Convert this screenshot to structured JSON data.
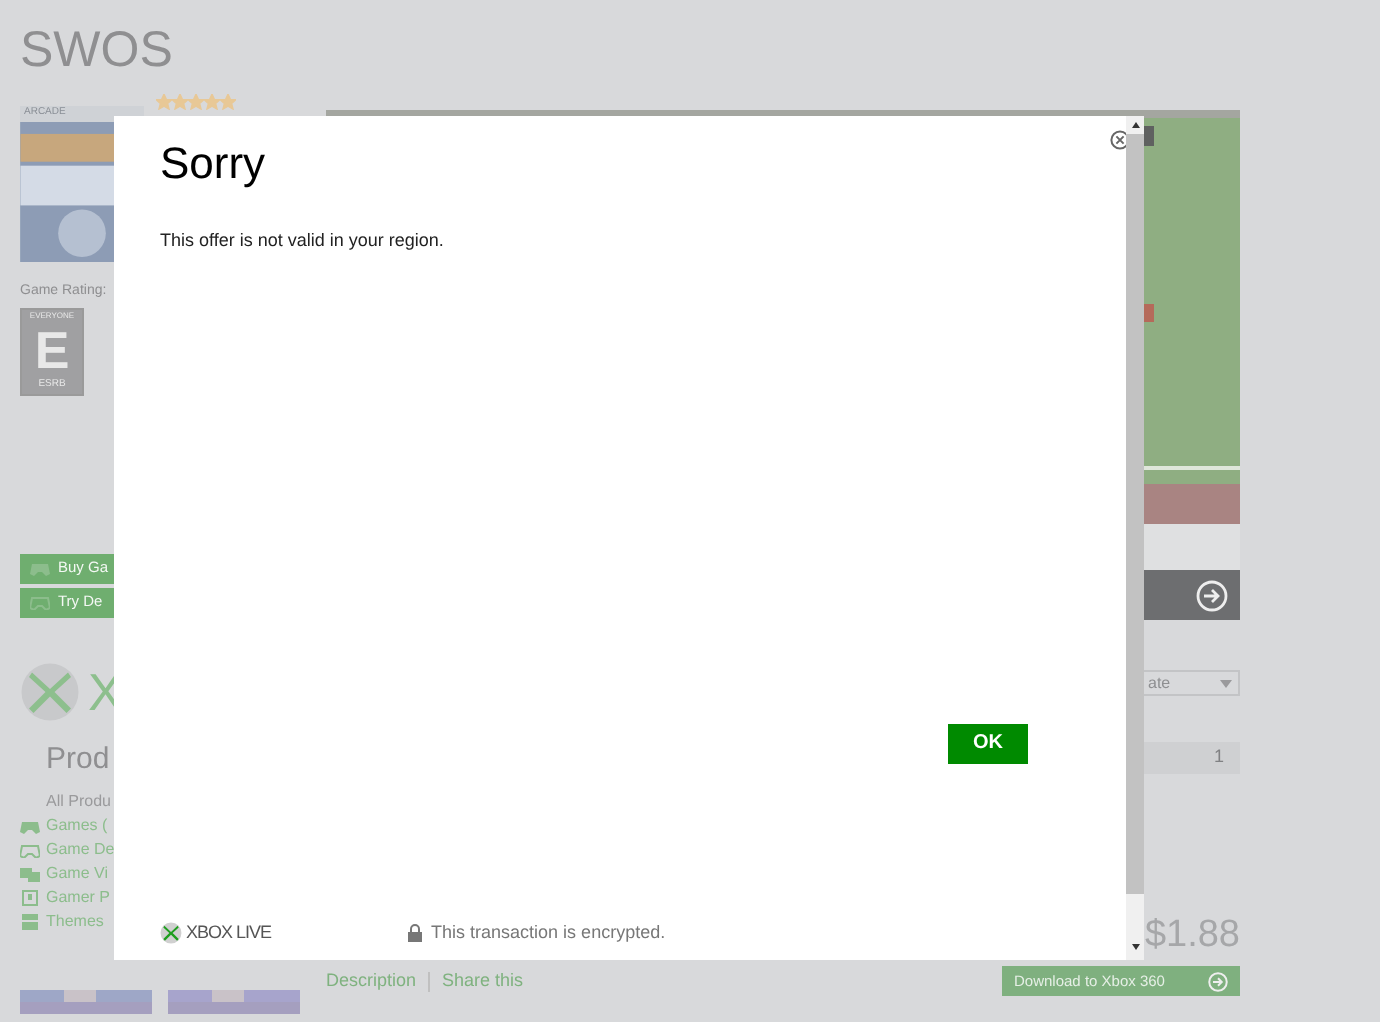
{
  "page": {
    "title": "SWOS",
    "cover_label": "ARCADE",
    "rating_label": "Game Rating:",
    "esrb": {
      "top": "EVERYONE",
      "letter": "E",
      "bottom": "ESRB"
    },
    "stars": 5,
    "buttons": [
      {
        "label": "Buy Ga",
        "kind": "buy"
      },
      {
        "label": "Try De",
        "kind": "trial"
      }
    ],
    "brand_letter": "X",
    "section_title": "Prod",
    "categories": [
      {
        "label": "All Produ",
        "kind": "all"
      },
      {
        "label": "Games (",
        "kind": "games"
      },
      {
        "label": "Game De",
        "kind": "demo"
      },
      {
        "label": "Game Vi",
        "kind": "video"
      },
      {
        "label": "Gamer P",
        "kind": "picture"
      },
      {
        "label": "Themes",
        "kind": "theme"
      }
    ],
    "sort": "ate",
    "pager": "1",
    "price": "$1.88",
    "tabs": [
      {
        "label": "Description"
      },
      {
        "label": "Share this"
      }
    ],
    "download": "Download to Xbox 360"
  },
  "dialog": {
    "title": "Sorry",
    "message": "This offer is not valid in your region.",
    "ok": "OK",
    "brand": "XBOX LIVE",
    "secure_note": "This transaction is encrypted."
  }
}
